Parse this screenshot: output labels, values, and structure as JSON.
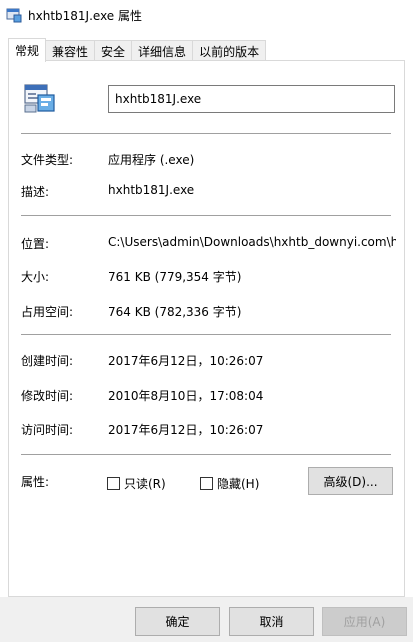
{
  "window": {
    "title": "hxhtb181J.exe 属性"
  },
  "tabs": [
    {
      "label": "常规"
    },
    {
      "label": "兼容性"
    },
    {
      "label": "安全"
    },
    {
      "label": "详细信息"
    },
    {
      "label": "以前的版本"
    }
  ],
  "general": {
    "file_name": "hxhtb181J.exe",
    "rows": [
      {
        "label": "文件类型:",
        "value": "应用程序 (.exe)"
      },
      {
        "label": "描述:",
        "value": "hxhtb181J.exe"
      },
      {
        "label": "位置:",
        "value": "C:\\Users\\admin\\Downloads\\hxhtb_downyi.com\\hx"
      },
      {
        "label": "大小:",
        "value": "761 KB (779,354 字节)"
      },
      {
        "label": "占用空间:",
        "value": "764 KB (782,336 字节)"
      },
      {
        "label": "创建时间:",
        "value": "2017年6月12日，10:26:07"
      },
      {
        "label": "修改时间:",
        "value": "2010年8月10日，17:08:04"
      },
      {
        "label": "访问时间:",
        "value": "2017年6月12日，10:26:07"
      }
    ],
    "attributes_label": "属性:",
    "readonly_label": "只读(R)",
    "hidden_label": "隐藏(H)",
    "advanced_label": "高级(D)..."
  },
  "buttons": {
    "ok": "确定",
    "cancel": "取消",
    "apply": "应用(A)"
  },
  "colors": {
    "accent": "#0078d7",
    "separator": "#a0a0a0",
    "footer": "#f0f0f0"
  }
}
